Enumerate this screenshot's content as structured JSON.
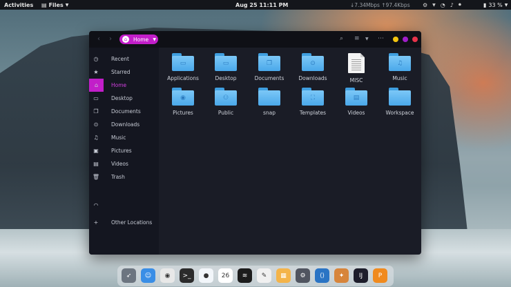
{
  "topbar": {
    "activities": "Activities",
    "app_name": "Files",
    "clock": "Aug 25  11:11 PM",
    "network": "↓7.34Mbps ↑97.4Kbps",
    "battery": "33 %"
  },
  "window": {
    "path_label": "Home",
    "window_buttons": [
      {
        "name": "minimize",
        "color": "#f2c40f"
      },
      {
        "name": "maximize",
        "color": "#a01ec9"
      },
      {
        "name": "close",
        "color": "#e8334a"
      }
    ]
  },
  "sidebar": {
    "items": [
      {
        "label": "Recent",
        "icon": "clock-icon",
        "glyph": "◷"
      },
      {
        "label": "Starred",
        "icon": "star-icon",
        "glyph": "★"
      },
      {
        "label": "Home",
        "icon": "home-icon",
        "glyph": "⌂",
        "active": true
      },
      {
        "label": "Desktop",
        "icon": "desktop-icon",
        "glyph": "▭"
      },
      {
        "label": "Documents",
        "icon": "documents-icon",
        "glyph": "❐"
      },
      {
        "label": "Downloads",
        "icon": "downloads-icon",
        "glyph": "⊙"
      },
      {
        "label": "Music",
        "icon": "music-icon",
        "glyph": "♫"
      },
      {
        "label": "Pictures",
        "icon": "pictures-icon",
        "glyph": "▣"
      },
      {
        "label": "Videos",
        "icon": "videos-icon",
        "glyph": "▤"
      },
      {
        "label": "Trash",
        "icon": "trash-icon",
        "glyph": "🗑"
      }
    ],
    "other_locations": "Other Locations"
  },
  "files": [
    {
      "name": "Applications",
      "type": "folder",
      "emblem": "▭"
    },
    {
      "name": "Desktop",
      "type": "folder",
      "emblem": "▭"
    },
    {
      "name": "Documents",
      "type": "folder",
      "emblem": "❐"
    },
    {
      "name": "Downloads",
      "type": "folder",
      "emblem": "⊙"
    },
    {
      "name": "MISC",
      "type": "document",
      "emblem": ""
    },
    {
      "name": "Music",
      "type": "folder",
      "emblem": "♫"
    },
    {
      "name": "Pictures",
      "type": "folder",
      "emblem": "◉"
    },
    {
      "name": "Public",
      "type": "folder",
      "emblem": "⚇"
    },
    {
      "name": "snap",
      "type": "folder",
      "emblem": ""
    },
    {
      "name": "Templates",
      "type": "folder",
      "emblem": "⛶"
    },
    {
      "name": "Videos",
      "type": "folder",
      "emblem": "▤"
    },
    {
      "name": "Workspace",
      "type": "folder",
      "emblem": ""
    }
  ],
  "dock": [
    {
      "icon": "rocket-launcher-icon",
      "color": "#6c7580",
      "glyph": "➶"
    },
    {
      "icon": "finder-icon",
      "color": "#3a8ee6",
      "glyph": "☺"
    },
    {
      "icon": "chrome-icon",
      "color": "#e8e8e8",
      "glyph": "◉"
    },
    {
      "icon": "terminal-icon",
      "color": "#2b2b2b",
      "glyph": ">_"
    },
    {
      "icon": "safari-icon",
      "color": "#f2f6fa",
      "glyph": "●"
    },
    {
      "icon": "calendar-icon",
      "color": "#ffffff",
      "glyph": "26"
    },
    {
      "icon": "spotify-icon",
      "color": "#1c1c1c",
      "glyph": "≋"
    },
    {
      "icon": "notes-icon",
      "color": "#f0f0f0",
      "glyph": "✎"
    },
    {
      "icon": "files-icon",
      "color": "#f4b44a",
      "glyph": "▦"
    },
    {
      "icon": "settings-icon",
      "color": "#505560",
      "glyph": "⚙"
    },
    {
      "icon": "vscode-icon",
      "color": "#2a74c4",
      "glyph": "⟨⟩"
    },
    {
      "icon": "gimp-icon",
      "color": "#d7853b",
      "glyph": "✦"
    },
    {
      "icon": "intellij-icon",
      "color": "#1d1d2b",
      "glyph": "IJ"
    },
    {
      "icon": "store-icon",
      "color": "#f08a1e",
      "glyph": "P"
    }
  ]
}
